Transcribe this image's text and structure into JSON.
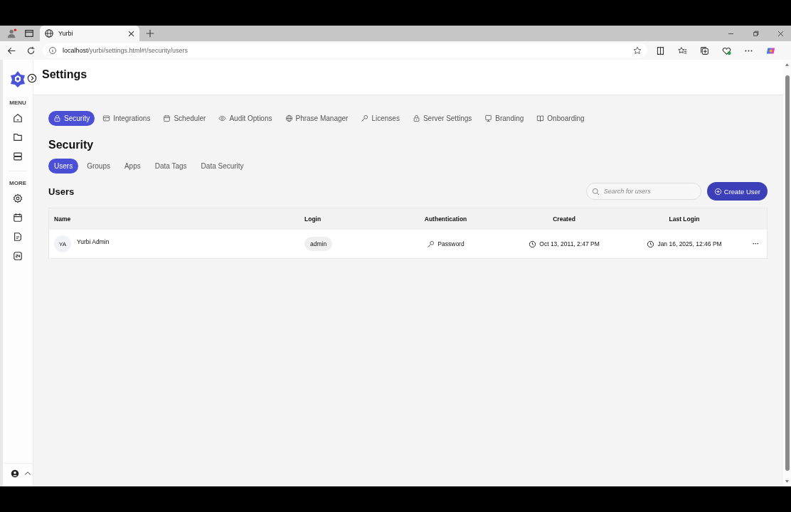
{
  "browser": {
    "tab_title": "Yurbi",
    "url_host": "localhost",
    "url_path": "/yurbi/settings.html#!/security/users"
  },
  "page_title": "Settings",
  "sidebar": {
    "sections": [
      {
        "heading": "MENU"
      },
      {
        "heading": "MORE"
      }
    ]
  },
  "settings_tabs": [
    {
      "label": "Security",
      "selected": true
    },
    {
      "label": "Integrations",
      "selected": false
    },
    {
      "label": "Scheduler",
      "selected": false
    },
    {
      "label": "Audit Options",
      "selected": false
    },
    {
      "label": "Phrase Manager",
      "selected": false
    },
    {
      "label": "Licenses",
      "selected": false
    },
    {
      "label": "Server Settings",
      "selected": false
    },
    {
      "label": "Branding",
      "selected": false
    },
    {
      "label": "Onboarding",
      "selected": false
    }
  ],
  "section_title": "Security",
  "security_tabs": [
    {
      "label": "Users",
      "selected": true
    },
    {
      "label": "Groups",
      "selected": false
    },
    {
      "label": "Apps",
      "selected": false
    },
    {
      "label": "Data Tags",
      "selected": false
    },
    {
      "label": "Data Security",
      "selected": false
    }
  ],
  "users": {
    "title": "Users",
    "search": {
      "placeholder": "Search for users"
    },
    "create_button": "Create User",
    "columns": [
      "Name",
      "Login",
      "Authentication",
      "Created",
      "Last Login"
    ],
    "rows": [
      {
        "initials": "YA",
        "name": "Yurbi Admin",
        "login": "admin",
        "authentication": "Password",
        "created": "Oct 13, 2011, 2:47 PM",
        "last_login": "Jan 16, 2025, 12:46 PM",
        "menu": "···"
      }
    ]
  }
}
